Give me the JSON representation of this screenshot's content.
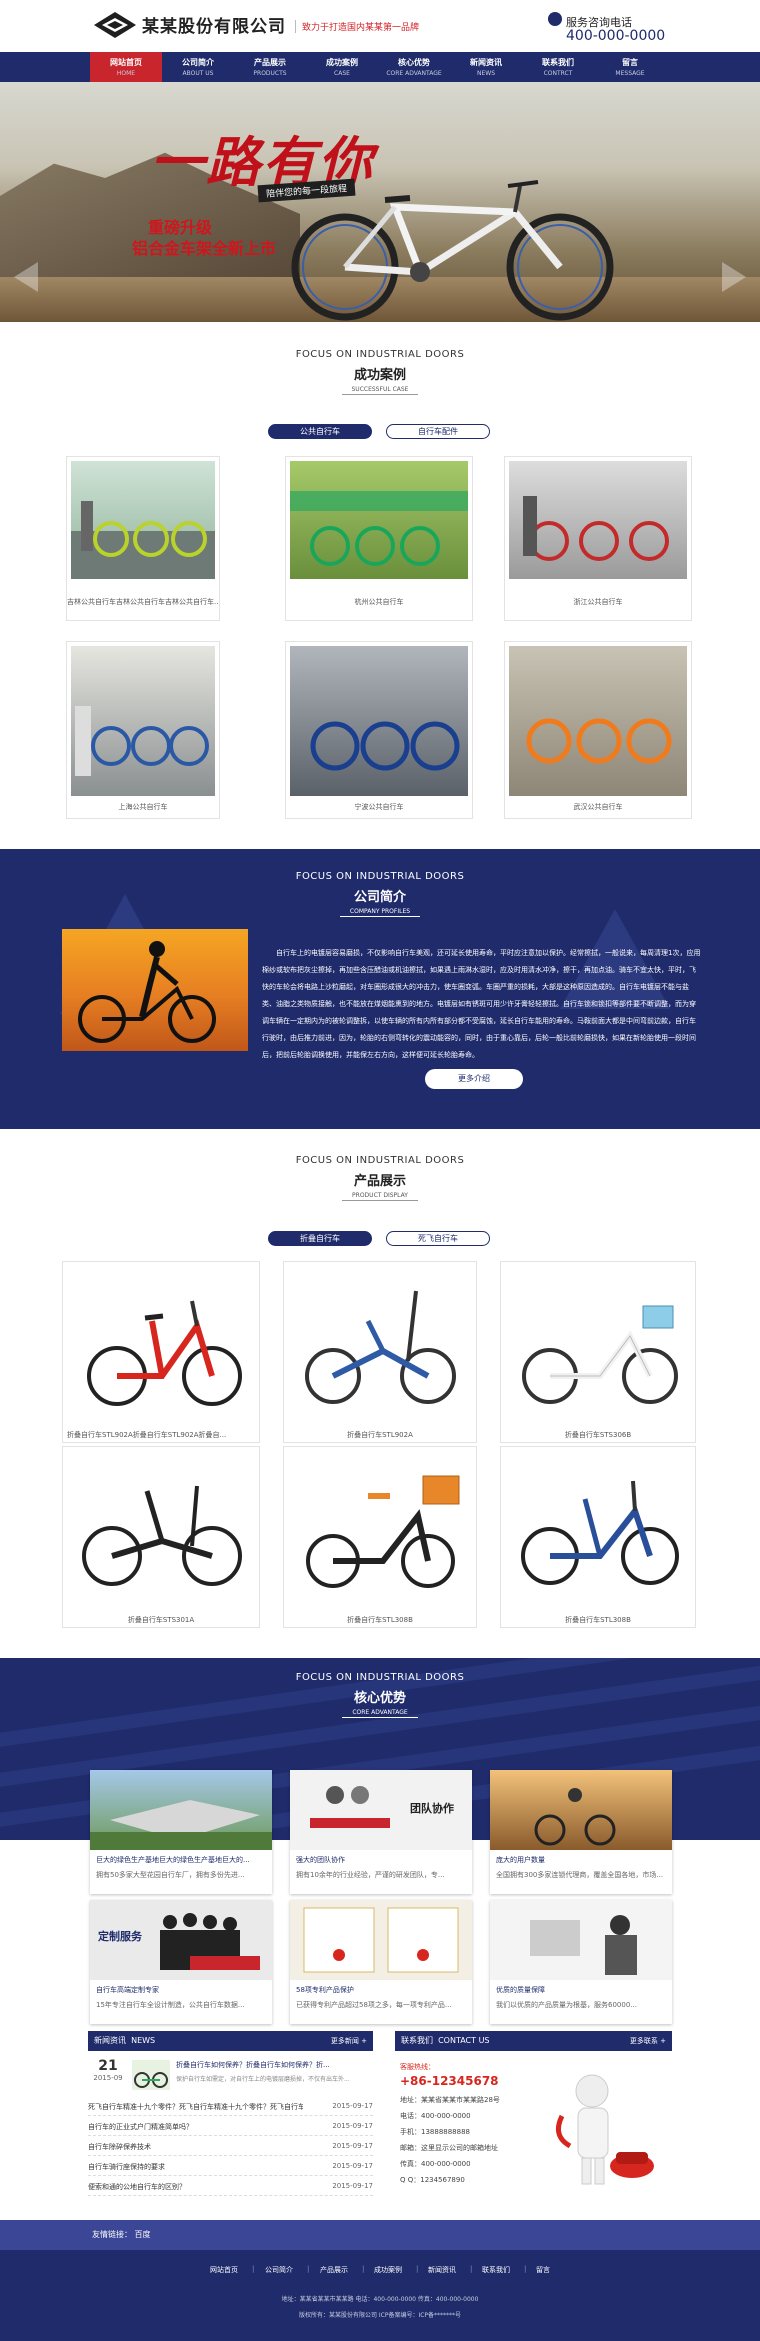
{
  "header": {
    "company_name": "某某股份有限公司",
    "slogan": "致力于打造国内某某第一品牌",
    "hotline_label": "服务咨询电话",
    "hotline_number": "400-000-0000"
  },
  "nav": [
    {
      "cn": "网站首页",
      "en": "HOME",
      "active": true
    },
    {
      "cn": "公司简介",
      "en": "ABOUT US"
    },
    {
      "cn": "产品展示",
      "en": "PRODUCTS"
    },
    {
      "cn": "成功案例",
      "en": "CASE"
    },
    {
      "cn": "核心优势",
      "en": "CORE ADVANTAGE"
    },
    {
      "cn": "新闻资讯",
      "en": "NEWS"
    },
    {
      "cn": "联系我们",
      "en": "CONTRCT"
    },
    {
      "cn": "留言",
      "en": "MESSAGE"
    }
  ],
  "banner": {
    "title": "一路有你",
    "tagline": "陪伴您的每一段旅程",
    "line1": "重磅升级",
    "line2": "铝合金车架全新上市",
    "colors": {
      "title": "#c0101a"
    }
  },
  "cases": {
    "en": "FOCUS ON INDUSTRIAL DOORS",
    "cn": "成功案例",
    "sub": "SUCCESSFUL CASE",
    "tabs": [
      "公共自行车",
      "自行车配件"
    ],
    "items": [
      "吉林公共自行车吉林公共自行车吉林公共自行车...",
      "杭州公共自行车",
      "浙江公共自行车",
      "上海公共自行车",
      "宁波公共自行车",
      "武汉公共自行车"
    ]
  },
  "about": {
    "en": "FOCUS ON INDUSTRIAL DOORS",
    "cn": "公司简介",
    "sub": "COMPANY PROFILES",
    "text": "自行车上的电镀层容易磨损，不仅影响自行车美观，还可延长使用寿命，平时应注意加以保护。经常擦拭，一般说来，每周清理1次，应用棉纱或软布把灰尘擦掉，再加些含压醋油或机油擦拭，如果遇上雨淋水湿时，应及时用清水冲净，擦干，再加点油。骑车不宜太快，平时，飞快的车轮会将电路上沙粒磨起，对车圈形成很大的冲击力，使车圈变弧。车圈严重的损耗，大部是这种原因造成的。自行车电镀层不能与盐类、油脂之类物质接触，也不能放在煤烟能熏到的地方。电镀层如有锈斑可用少许牙膏轻轻擦拭。自行车锁和锁扣等部件要不断调整，而为穿调车辆在一定期内为的被轮调整拆，以使车辆的所有内所有部分都不受腐蚀，延长自行车能用的寿命。马鞍前面大都是中间弯前边款，自行车行驶时，由后推力前进，因为，轮胎的右侧弯转化的震动能容的，同时，由于重心靠后，后轮一般比前轮磨损快，如果在新轮胎使用一段时间后，把前后轮胎调换使用，并能保左右方向，这样便可延长轮胎寿命。",
    "more": "更多介绍"
  },
  "products": {
    "en": "FOCUS ON INDUSTRIAL DOORS",
    "cn": "产品展示",
    "sub": "PRODUCT DISPLAY",
    "tabs": [
      "折叠自行车",
      "死飞自行车"
    ],
    "items": [
      "折叠自行车STL902A折叠自行车STL902A折叠自...",
      "折叠自行车STL902A",
      "折叠自行车STS306B",
      "折叠自行车STS301A",
      "折叠自行车STL308B",
      "折叠自行车STL308B"
    ]
  },
  "advantage": {
    "en": "FOCUS ON INDUSTRIAL DOORS",
    "cn": "核心优势",
    "sub": "CORE ADVANTAGE",
    "cards": [
      {
        "title": "巨大的绿色生产基地巨大的绿色生产基地巨大的...",
        "desc": "拥有50多家大型花园自行车厂，拥有多份先进...",
        "image_text": ""
      },
      {
        "title": "强大的团队协作",
        "desc": "拥有10余年的行业经验，严谨的研发团队，专...",
        "image_text": "团队协作"
      },
      {
        "title": "庞大的用户数量",
        "desc": "全国拥有300多家连锁代理商，覆盖全国各地，市场...",
        "image_text": ""
      },
      {
        "title": "自行车高端定制专家",
        "desc": "15年专注自行车全设计制造，公共自行车数据...",
        "image_text": "定制服务"
      },
      {
        "title": "58项专利产品保护",
        "desc": "已获得专利产品超过58项之多，每一项专利产品...",
        "image_text": ""
      },
      {
        "title": "优质的质量保障",
        "desc": "我们以优质的产品质量为根基，服务60000...",
        "image_text": ""
      }
    ]
  },
  "news": {
    "title": "新闻资讯",
    "title_en": "NEWS",
    "more": "更多新闻 +",
    "featured": {
      "day": "21",
      "ym": "2015-09",
      "title": "折叠自行车如何保养？折叠自行车如何保养？折...",
      "desc": "保护自行车如需定，对自行车上的电镀层磨损掉，不仅有出车外..."
    },
    "items": [
      {
        "t": "死飞自行车精准十九个零件？死飞自行车精准十九个零件？死飞自行车精准十...",
        "d": "2015-09-17"
      },
      {
        "t": "自行车的正业式户门精准简单吗？",
        "d": "2015-09-17"
      },
      {
        "t": "自行车除碎保养技术",
        "d": "2015-09-17"
      },
      {
        "t": "自行车骑行座保持的要求",
        "d": "2015-09-17"
      },
      {
        "t": "便索和通的公地自行车的区别？",
        "d": "2015-09-17"
      }
    ]
  },
  "contact": {
    "title": "联系我们",
    "title_en": "CONTACT US",
    "more": "更多联系 +",
    "hotline_label": "客服热线：",
    "hotline": "+86-12345678",
    "rows": [
      "地址：某某省某某市某某路28号",
      "电话：400-000-0000",
      "手机：13888888888",
      "邮箱：这里显示公司的邮箱地址",
      "传真：400-000-0000",
      "Q  Q：1234567890"
    ]
  },
  "footer": {
    "links_label": "友情链接：",
    "links": [
      "百度"
    ],
    "nav": [
      "网站首页",
      "公司简介",
      "产品展示",
      "成功案例",
      "新闻资讯",
      "联系我们",
      "留言"
    ],
    "info1": "地址：某某省某某市某某路  电话：400-000-0000  传真：400-000-0000",
    "info2": "版权所有：某某股份有限公司  ICP备案编号：ICP备*******号"
  }
}
